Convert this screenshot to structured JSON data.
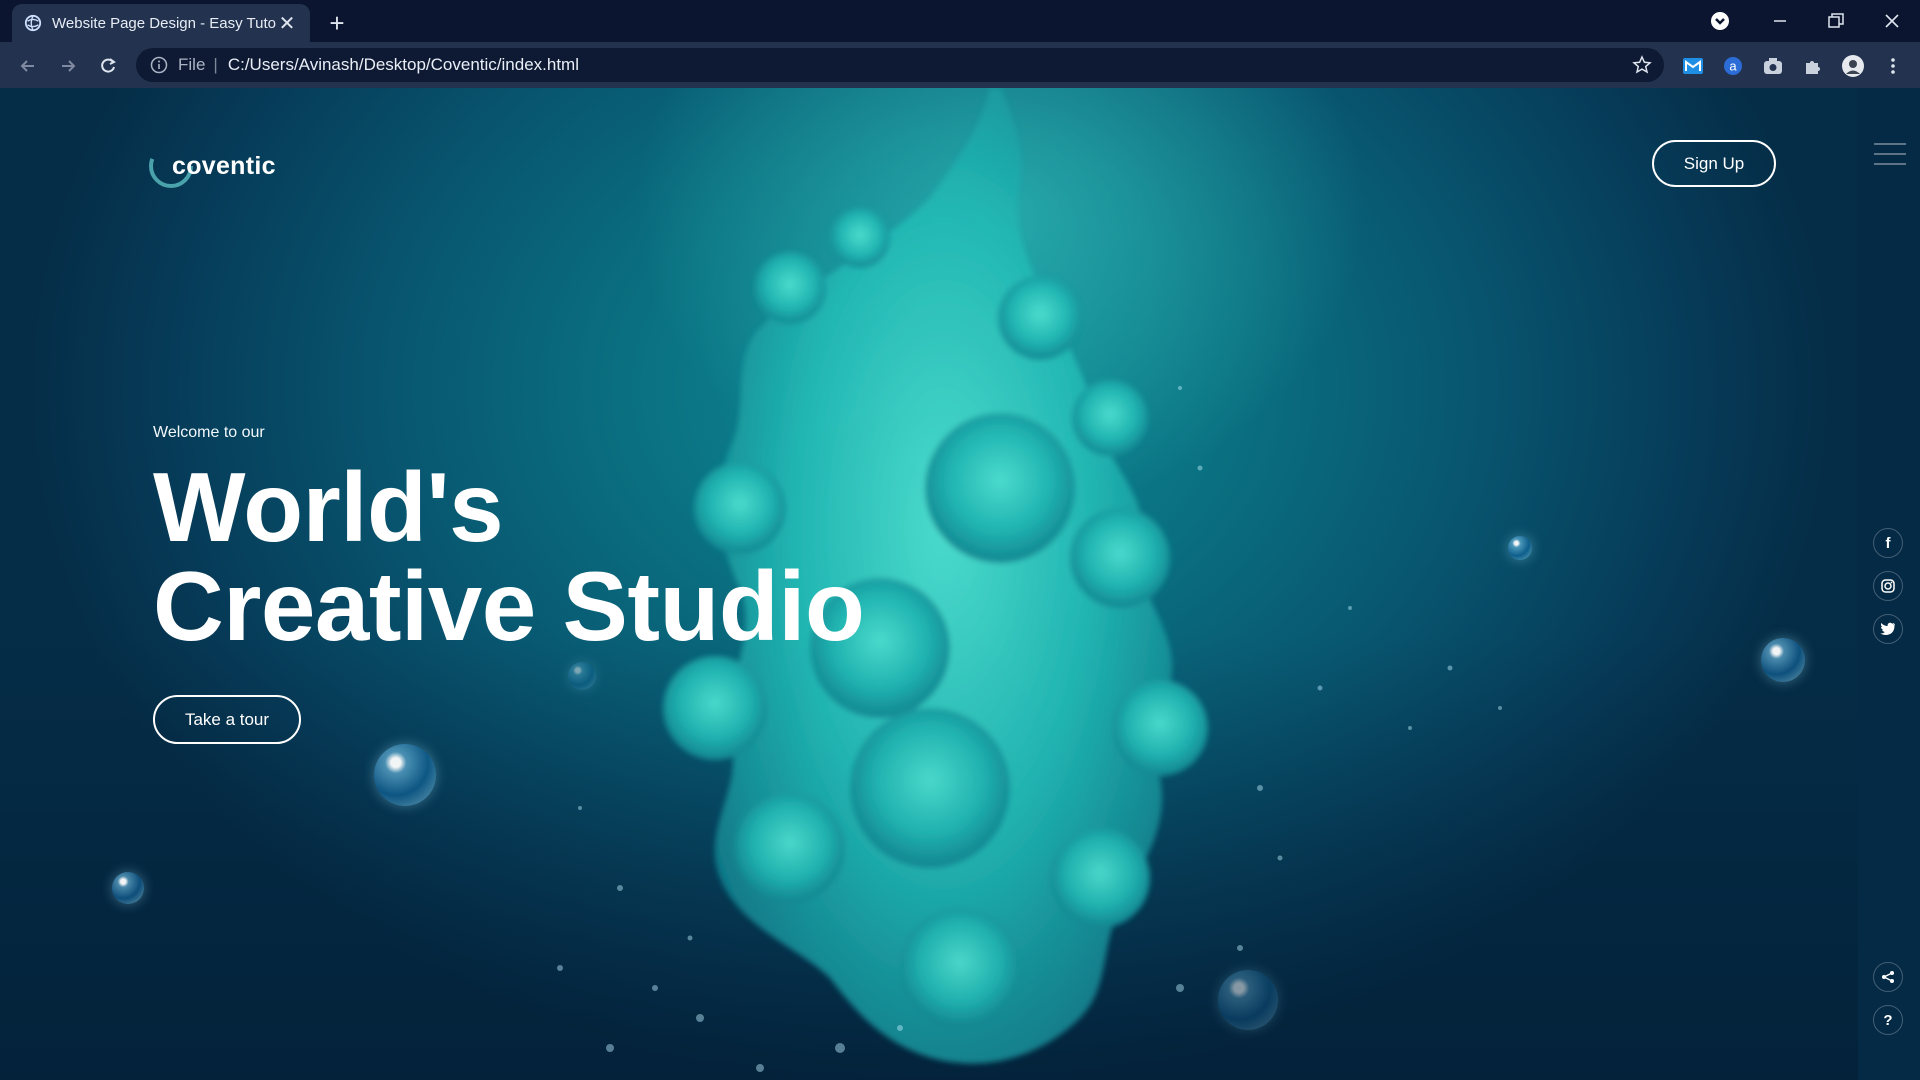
{
  "browser": {
    "tab_title": "Website Page Design - Easy Tuto",
    "url_scheme": "File",
    "url": "C:/Users/Avinash/Desktop/Coventic/index.html",
    "new_tab_symbol": "+",
    "close_symbol": "✕"
  },
  "site": {
    "logo_text": "coventic",
    "signup_label": "Sign Up",
    "welcome": "Welcome to our",
    "headline_line1": "World's",
    "headline_line2": "Creative Studio",
    "tour_label": "Take a tour"
  },
  "social": {
    "facebook": "f",
    "instagram": "instagram-icon",
    "twitter": "twitter-icon",
    "share": "share-icon",
    "help": "?"
  },
  "colors": {
    "accent": "#13b3b0",
    "chrome_dark": "#0b1530",
    "chrome_toolbar": "#22324f",
    "text_white": "#ffffff"
  }
}
